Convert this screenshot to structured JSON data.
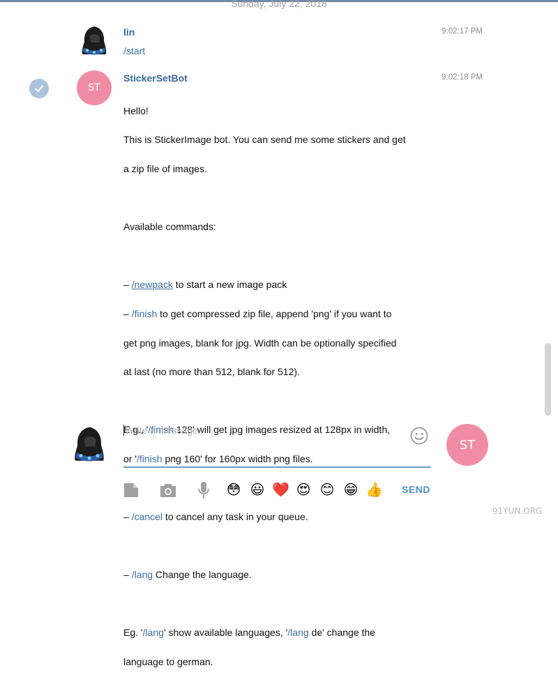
{
  "date_header": "Sunday, July 22, 2018",
  "messages": [
    {
      "sender": "lin",
      "time": "9:02:17 PM",
      "text": "/start"
    },
    {
      "sender": "StickerSetBot",
      "avatar_initials": "ST",
      "time": "9:02:18 PM",
      "line1": "Hello!",
      "line2": "This is StickerImage bot. You can send me some stickers and get",
      "line3": "a zip file of images.",
      "line4": "Available commands:",
      "newpack_prefix": "– ",
      "newpack_cmd": "/newpack",
      "newpack_rest": " to start a new image pack",
      "finish_prefix": "– ",
      "finish_cmd": "/finish",
      "finish_rest1": " to get compressed zip file, append 'png' if you want to",
      "finish_rest2": "get png images, blank for jpg. Width can be optionally specified",
      "finish_rest3": "at last (no more than 512, blank for 512).",
      "eg1_a": "E.g., '",
      "eg1_cmd": "/finish",
      "eg1_b": " 128' will get jpg images resized at 128px in width,",
      "eg2_a": "or '",
      "eg2_cmd": "/finish",
      "eg2_b": " png 160' for 160px width png files.",
      "cancel_prefix": "– ",
      "cancel_cmd": "/cancel",
      "cancel_rest": " to cancel any task in your queue.",
      "lang_prefix": "– ",
      "lang_cmd": "/lang",
      "lang_rest": " Change the language.",
      "eg3_a": "Eg. '",
      "eg3_cmd1": "/lang",
      "eg3_b": "' show available languages, '",
      "eg3_cmd2": "/lang",
      "eg3_c": " de' change the",
      "eg3_d": "language to german."
    }
  ],
  "composer": {
    "placeholder": "Write a message...",
    "bot_avatar_initials": "ST",
    "send_label": "SEND"
  },
  "toolbar": {
    "icons": [
      "file-icon",
      "camera-icon",
      "microphone-icon"
    ],
    "emojis": [
      "😳",
      "😃",
      "❤️",
      "😍",
      "😊",
      "😁",
      "👍"
    ]
  },
  "watermark": "91YUN.ORG",
  "colors": {
    "link": "#3b6fa0",
    "name": "#3a6a9c",
    "avatar_st": "#f08da5",
    "send": "#4c8cc8",
    "input_line": "#6a9ac8"
  }
}
